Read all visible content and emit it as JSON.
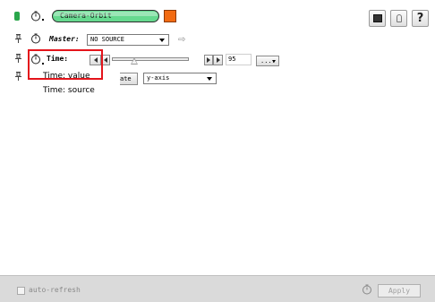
{
  "header": {
    "object_name": "Camera-Orbit",
    "object_color": "#f26b12",
    "title_field_color": "#66d98f",
    "icons": [
      "save-icon",
      "lock-icon",
      "help-icon"
    ]
  },
  "master": {
    "label": "Master:",
    "value": "NO SOURCE"
  },
  "time": {
    "label": "Time:",
    "value": "95",
    "more_label": "...."
  },
  "axis": {
    "partial_button_label": "ate",
    "value": "y-axis"
  },
  "menu": {
    "items": [
      "Time: value",
      "Time: source"
    ]
  },
  "footer": {
    "checkbox_label": "auto-refresh",
    "apply_label": "Apply"
  }
}
